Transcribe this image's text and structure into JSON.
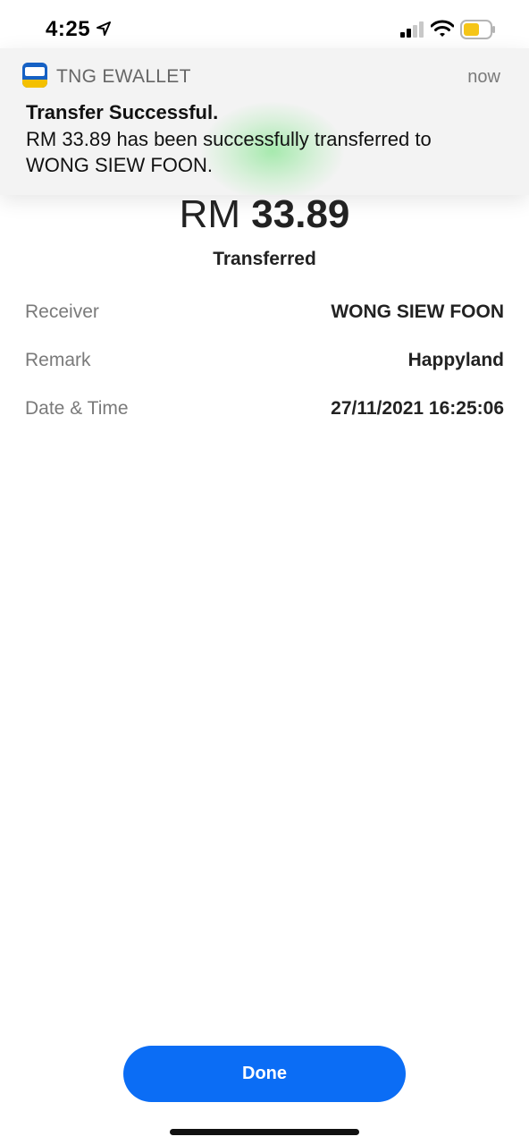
{
  "status_bar": {
    "time": "4:25",
    "icons": [
      "location-arrow-icon",
      "cellular-signal-icon",
      "wifi-icon",
      "battery-icon"
    ],
    "battery_color": "#f5c518"
  },
  "notification": {
    "app_name": "TNG EWALLET",
    "time": "now",
    "title": "Transfer Successful.",
    "body": "RM 33.89 has been successfully transferred to WONG SIEW FOON.",
    "app_icon": "touch-n-go-ewallet-icon"
  },
  "amount": {
    "currency": "RM",
    "value": "33.89",
    "status": "Transferred"
  },
  "details": [
    {
      "label": "Receiver",
      "value": "WONG SIEW FOON"
    },
    {
      "label": "Remark",
      "value": "Happyland"
    },
    {
      "label": "Date & Time",
      "value": "27/11/2021 16:25:06"
    }
  ],
  "done_button": {
    "label": "Done",
    "color": "#0b6df5"
  }
}
